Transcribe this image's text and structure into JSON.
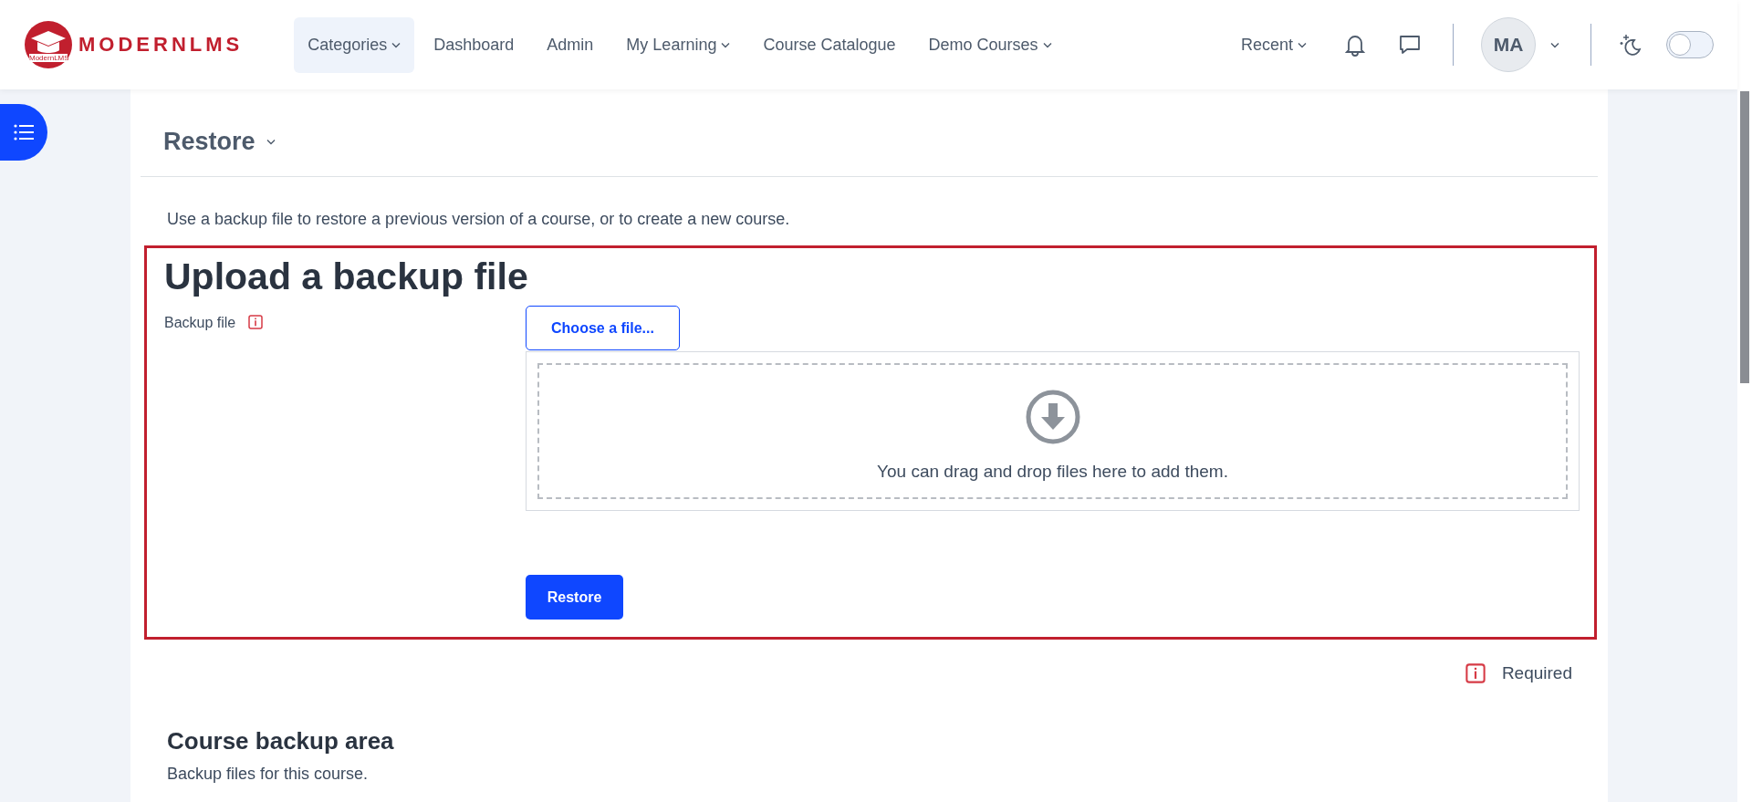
{
  "logo": {
    "text": "MODERNLMS",
    "badge_text": "ModernLMS"
  },
  "nav": [
    {
      "label": "Categories",
      "selected": true,
      "dropdown": true
    },
    {
      "label": "Dashboard",
      "selected": false,
      "dropdown": false
    },
    {
      "label": "Admin",
      "selected": false,
      "dropdown": false
    },
    {
      "label": "My Learning",
      "selected": false,
      "dropdown": true
    },
    {
      "label": "Course Catalogue",
      "selected": false,
      "dropdown": false
    },
    {
      "label": "Demo Courses",
      "selected": false,
      "dropdown": true
    }
  ],
  "header_right": {
    "recent": "Recent",
    "avatar": "MA",
    "dark_mode": {
      "on": false
    }
  },
  "page": {
    "title": "Restore",
    "intro": "Use a backup file to restore a previous version of a course, or to create a new course.",
    "upload": {
      "heading": "Upload a backup file",
      "field_label": "Backup file",
      "choose_button": "Choose a file...",
      "drop_text": "You can drag and drop files here to add them.",
      "submit": "Restore"
    },
    "required_note": "Required",
    "backup_area": {
      "heading": "Course backup area",
      "text": "Backup files for this course."
    }
  }
}
